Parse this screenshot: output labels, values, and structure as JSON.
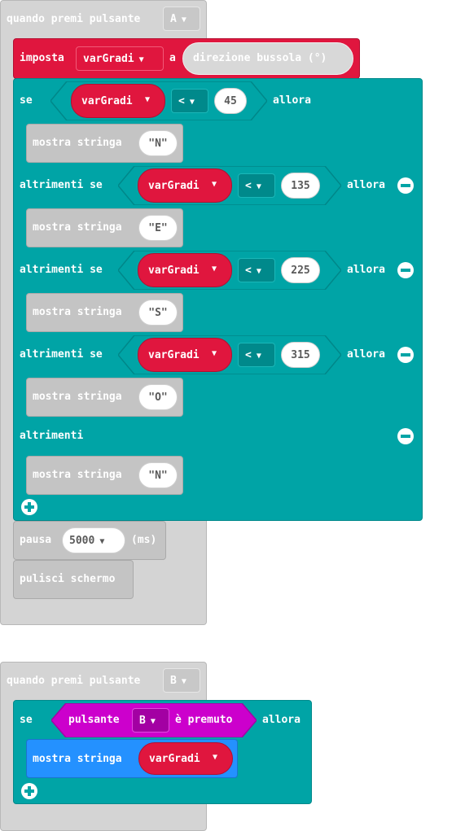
{
  "colors": {
    "event_grey": "#d4d4d4",
    "logic_teal": "#00a4a6",
    "variable_red": "#e0163e",
    "input_pink": "#cc00cc",
    "basic_blue": "#2491ff"
  },
  "event_a": {
    "label": "quando premi pulsante",
    "button": "A",
    "set_block": {
      "label": "imposta",
      "variable": "varGradi",
      "to_label": "a",
      "value": "direzione bussola (°)"
    },
    "if_block": {
      "if_label": "se",
      "then_label": "allora",
      "elseif_label": "altrimenti se",
      "else_label": "altrimenti",
      "branches": [
        {
          "variable": "varGradi",
          "operator": "<",
          "value": "45",
          "show": "mostra stringa",
          "string": "\"N\""
        },
        {
          "variable": "varGradi",
          "operator": "<",
          "value": "135",
          "show": "mostra stringa",
          "string": "\"E\""
        },
        {
          "variable": "varGradi",
          "operator": "<",
          "value": "225",
          "show": "mostra stringa",
          "string": "\"S\""
        },
        {
          "variable": "varGradi",
          "operator": "<",
          "value": "315",
          "show": "mostra stringa",
          "string": "\"O\""
        }
      ],
      "else_show": "mostra stringa",
      "else_string": "\"N\""
    },
    "pause": {
      "label": "pausa",
      "value": "5000",
      "unit": "(ms)"
    },
    "clear": {
      "label": "pulisci schermo"
    }
  },
  "event_b": {
    "label": "quando premi pulsante",
    "button": "B",
    "if_label": "se",
    "condition": {
      "label": "pulsante",
      "button": "B",
      "suffix": "è premuto"
    },
    "then_label": "allora",
    "show": {
      "label": "mostra stringa",
      "variable": "varGradi"
    }
  },
  "icons": {
    "remove": "minus-circle-icon",
    "add": "plus-circle-icon",
    "dropdown": "caret-down-icon"
  }
}
